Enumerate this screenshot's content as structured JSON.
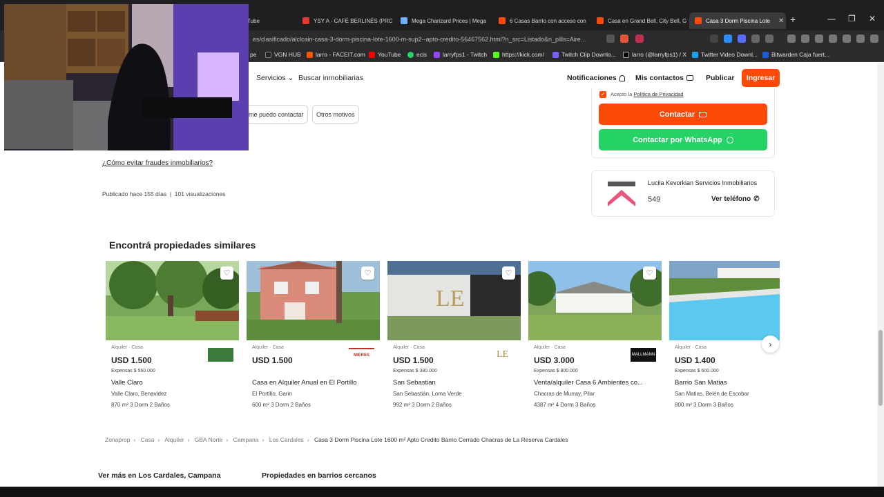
{
  "browser": {
    "tabs": [
      {
        "label": "Tube",
        "color": "#888888"
      },
      {
        "label": "YSY A - CAFÉ BERLINÉS (PROD",
        "color": "#e53935"
      },
      {
        "label": "Mega Charizard Prices | Mega",
        "color": "#6fb0ff"
      },
      {
        "label": "6 Casas Barrio con acceso con",
        "color": "#fc4b08"
      },
      {
        "label": "Casa en Grand Bell, City Bell, G",
        "color": "#fc4b08"
      },
      {
        "label": "Casa 3 Dorm Piscina Lote",
        "color": "#fc4b08"
      }
    ],
    "url": "es/clasificado/alclcain-casa-3-dorm-piscina-lote-1600-m-sup2--apto-credito-56467562.html?n_src=Listado&n_pills=Aire...",
    "bookmarks": [
      {
        "label": "pe",
        "color": "#999999"
      },
      {
        "label": "VGN HUB",
        "color": "#222222"
      },
      {
        "label": "larro - FACEIT.com",
        "color": "#ff5500"
      },
      {
        "label": "YouTube",
        "color": "#ff0000"
      },
      {
        "label": "ecis",
        "color": "#25d366"
      },
      {
        "label": "larryfps1 - Twitch",
        "color": "#9146ff"
      },
      {
        "label": "https://kick.com/",
        "color": "#53fc18"
      },
      {
        "label": "Twitch Clip Downlo...",
        "color": "#7c5cff"
      },
      {
        "label": "larro (@larryfps1) / X",
        "color": "#ffffff"
      },
      {
        "label": "Twitter Video Downl...",
        "color": "#1da1f2"
      },
      {
        "label": "Bitwarden Caja fuert...",
        "color": "#175ddc"
      }
    ]
  },
  "header": {
    "servicios": "Servicios",
    "buscar": "Buscar inmobiliarias",
    "notificaciones": "Notificaciones",
    "contactos": "Mis contactos",
    "publicar": "Publicar",
    "ingresar": "Ingresar"
  },
  "chips": [
    "me puedo contactar",
    "Otros motivos"
  ],
  "contact": {
    "privacy_prefix": "Acepto la",
    "privacy_link": "Política de Privacidad",
    "contactar": "Contactar",
    "whatsapp": "Contactar por WhatsApp"
  },
  "agency": {
    "name": "Lucila Kevorkian Servicios Inmobiliarios",
    "phone": "549",
    "ver_telefono": "Ver teléfono"
  },
  "fraude": "¿Cómo evitar fraudes inmobiliarios?",
  "publicado": "Publicado hace 155 días",
  "visualizaciones": "101 visualizaciones",
  "similares_title": "Encontrá propiedades similares",
  "cards": [
    {
      "kind": "Alquiler · Casa",
      "price": "USD 1.500",
      "expensas": "Expensas $ 560.000",
      "title": "Valle Claro",
      "loc": "Valle Claro, Benavidez",
      "feat": "870 m²   3 Dorm   2 Baños",
      "logo": ""
    },
    {
      "kind": "Alquiler · Casa",
      "price": "USD 1.500",
      "expensas": "",
      "title": "Casa en Alquiler Anual en El Portillo",
      "loc": "El Portillo, Garin",
      "feat": "600 m²   3 Dorm   2 Baños",
      "logo": "MIERES"
    },
    {
      "kind": "Alquiler · Casa",
      "price": "USD 1.500",
      "expensas": "Expensas $ 380.000",
      "title": "San Sebastian",
      "loc": "San Sebastián, Loma Verde",
      "feat": "992 m²   3 Dorm   2 Baños",
      "logo": "LE"
    },
    {
      "kind": "Alquiler · Casa",
      "price": "USD 3.000",
      "expensas": "Expensas $ 800.000",
      "title": "Venta/alquiler Casa 6 Ambientes co...",
      "loc": "Chacras de Murray, Pilar",
      "feat": "4387 m²   4 Dorm   3 Baños",
      "logo": "MALLMANN"
    },
    {
      "kind": "Alquiler · Casa",
      "price": "USD 1.400",
      "expensas": "Expensas $ 600.000",
      "title": "Barrio San Matias",
      "loc": "San Matias, Belén de Escobar",
      "feat": "800 m²   3 Dorm   3 Baños",
      "logo": ""
    }
  ],
  "breadcrumb": [
    "Zonaprop",
    "Casa",
    "Alquiler",
    "GBA Norte",
    "Campana",
    "Los Cardales"
  ],
  "breadcrumb_current": "Casa 3 Dorm Piscina Lote 1600 m² Apto Credito Barrio Cerrado Chacras de La Reserva Cardales",
  "bottom": {
    "ver_mas": "Ver más en Los Cardales, Campana",
    "barrios": "Propiedades en barrios cercanos"
  }
}
